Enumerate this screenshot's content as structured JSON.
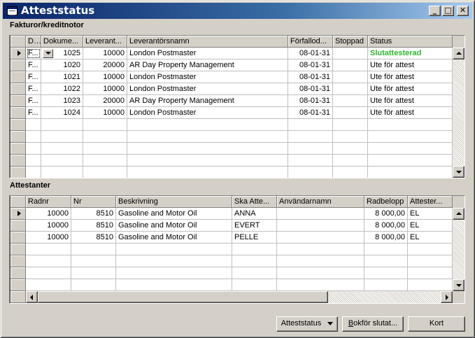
{
  "window": {
    "title": "Atteststatus",
    "controls": {
      "minimize": "_",
      "maximize": "□",
      "close": "✕"
    }
  },
  "invoices": {
    "section_label": "Fakturor/kreditnotor",
    "columns": [
      "D...",
      "Dokume...",
      "Leverant...",
      "Leverantörsnamn",
      "Förfallod...",
      "Stoppad",
      "Status"
    ],
    "rows": [
      {
        "d": "F...",
        "doc": "1025",
        "vendor_no": "10000",
        "vendor_name": "London Postmaster",
        "due": "08-01-31",
        "stopped": "",
        "status": "Slutattesterad"
      },
      {
        "d": "F...",
        "doc": "1020",
        "vendor_no": "20000",
        "vendor_name": "AR Day Property Management",
        "due": "08-01-31",
        "stopped": "",
        "status": "Ute för attest"
      },
      {
        "d": "F...",
        "doc": "1021",
        "vendor_no": "10000",
        "vendor_name": "London Postmaster",
        "due": "08-01-31",
        "stopped": "",
        "status": "Ute för attest"
      },
      {
        "d": "F...",
        "doc": "1022",
        "vendor_no": "10000",
        "vendor_name": "London Postmaster",
        "due": "08-01-31",
        "stopped": "",
        "status": "Ute för attest"
      },
      {
        "d": "F...",
        "doc": "1023",
        "vendor_no": "20000",
        "vendor_name": "AR Day Property Management",
        "due": "08-01-31",
        "stopped": "",
        "status": "Ute för attest"
      },
      {
        "d": "F...",
        "doc": "1024",
        "vendor_no": "10000",
        "vendor_name": "London Postmaster",
        "due": "08-01-31",
        "stopped": "",
        "status": "Ute för attest"
      }
    ]
  },
  "approvers": {
    "section_label": "Attestanter",
    "columns": [
      "Radnr",
      "Nr",
      "Beskrivning",
      "Ska Atte...",
      "Användarnamn",
      "Radbelopp",
      "Attester..."
    ],
    "rows": [
      {
        "line": "10000",
        "no": "8510",
        "desc": "Gasoline and Motor Oil",
        "approver": "ANNA",
        "user": "",
        "amount": "8 000,00",
        "att": "EL"
      },
      {
        "line": "10000",
        "no": "8510",
        "desc": "Gasoline and Motor Oil",
        "approver": "EVERT",
        "user": "",
        "amount": "8 000,00",
        "att": "EL"
      },
      {
        "line": "10000",
        "no": "8510",
        "desc": "Gasoline and Motor Oil",
        "approver": "PELLE",
        "user": "",
        "amount": "8 000,00",
        "att": "EL"
      }
    ]
  },
  "buttons": {
    "atteststatus": "Atteststatus",
    "bokfor_prefix": "B",
    "bokfor_rest": "okför slutat...",
    "kort": "Kort"
  },
  "colors": {
    "status_final": "#2db52d",
    "title_start": "#0a246a",
    "title_end": "#a6caf0"
  }
}
